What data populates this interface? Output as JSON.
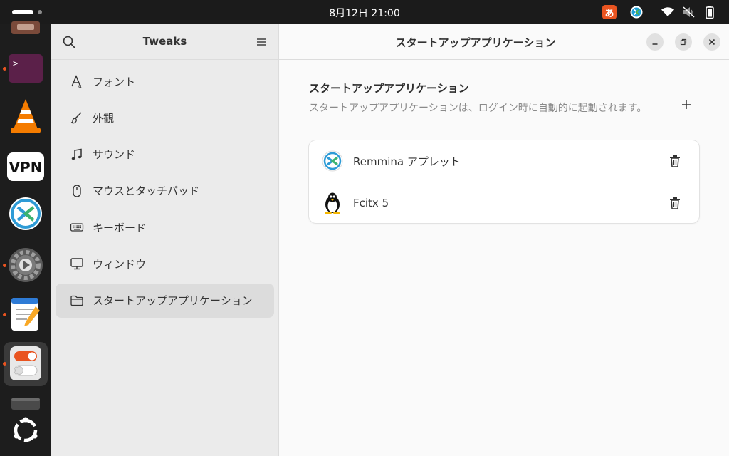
{
  "topbar": {
    "clock": "8月12日  21:00",
    "ime_label": "あ"
  },
  "dock": {
    "items": [
      {
        "name": "files-app-icon"
      },
      {
        "name": "terminal-app-icon",
        "running": true
      },
      {
        "name": "vlc-app-icon"
      },
      {
        "name": "vpn-app-icon",
        "label": "VPN"
      },
      {
        "name": "remmina-app-icon"
      },
      {
        "name": "settings-app-icon",
        "running": true
      },
      {
        "name": "text-editor-app-icon",
        "running": true
      },
      {
        "name": "tweaks-app-icon",
        "running": true,
        "active": true
      },
      {
        "name": "trash-app-icon"
      },
      {
        "name": "show-apps-icon"
      }
    ]
  },
  "sidebar": {
    "title": "Tweaks",
    "items": [
      {
        "label": "フォント",
        "icon": "font-icon"
      },
      {
        "label": "外観",
        "icon": "appearance-brush-icon"
      },
      {
        "label": "サウンド",
        "icon": "music-note-icon"
      },
      {
        "label": "マウスとタッチパッド",
        "icon": "mouse-icon"
      },
      {
        "label": "キーボード",
        "icon": "keyboard-icon"
      },
      {
        "label": "ウィンドウ",
        "icon": "monitor-icon"
      },
      {
        "label": "スタートアップアプリケーション",
        "icon": "folder-icon",
        "selected": true
      }
    ]
  },
  "content": {
    "title": "スタートアップアプリケーション",
    "section_title": "スタートアップアプリケーション",
    "section_desc": "スタートアップアプリケーションは、ログイン時に自動的に起動されます。",
    "apps": [
      {
        "label": "Remmina アプレット",
        "icon": "remmina-icon"
      },
      {
        "label": "Fcitx 5",
        "icon": "tux-penguin-icon"
      }
    ]
  },
  "colors": {
    "accent": "#e95420",
    "sidebar_bg": "#ebebeb",
    "content_bg": "#fafafa",
    "dock_bg": "#1d1d1d"
  }
}
